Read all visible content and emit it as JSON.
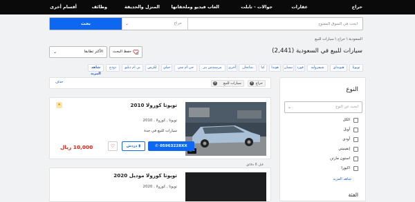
{
  "nav": {
    "items": [
      "حراج",
      "عقارات",
      "جوالات - تابلت",
      "العاب فيديو وملحقاتها",
      "المنزل والحديقة",
      "وظائف",
      "أقسام أخرى"
    ]
  },
  "search": {
    "button_label": "بحث",
    "category_placeholder": "حراج",
    "keyword_placeholder": "ابحث في السوق المفتوح"
  },
  "breadcrumb": "السعودية \\ حراج \\ سيارات للبيع",
  "page": {
    "title": "سيارات للبيع في السعودية (2,441)"
  },
  "sort": {
    "label": "الأكثر تطابقا"
  },
  "save_search": {
    "label": "حفظ البحث"
  },
  "brand_chips": [
    "تويوتا",
    "هيونداي",
    "شيفروليه",
    "فورد",
    "نيسان",
    "هوندا",
    "كيا",
    "شانجان",
    "أخرى",
    "مرسيدس بنز",
    "جي ام سي",
    "جيلي",
    "لكزس",
    "بي ام دبليو",
    "دودج",
    "شاهد المزيد"
  ],
  "active_filters": {
    "chips": [
      "حراج",
      "سيارات للبيع"
    ],
    "clear_label": "حذف"
  },
  "listings": [
    {
      "title": "تويوتا كورولا 2010",
      "model": "تويوتا , كورولا , 2010",
      "location": "سيارات للبيع في جدة",
      "price": "10,000 ريال",
      "phone": "05963228XX",
      "chat_label": "دردش",
      "photo_count": "5",
      "date": "قبل 6 دقائق"
    },
    {
      "title": "تويوتا كورولا موديل 2020",
      "model": "تويوتا , كورولا , 2020"
    }
  ],
  "sidebar": {
    "heading": "النوع",
    "select_placeholder": "ابحث عن النوع",
    "options": [
      "الكل",
      "أوبل",
      "أودي",
      "إنفينيتي",
      "استون مارتن",
      "اكيورا"
    ],
    "more_link": "شاهد المزيد",
    "section2": "الفئة"
  },
  "colors": {
    "nav_bg": "#0a0a0a",
    "primary": "#0d67f0",
    "price": "#e1251b",
    "link": "#1f5bc8"
  }
}
